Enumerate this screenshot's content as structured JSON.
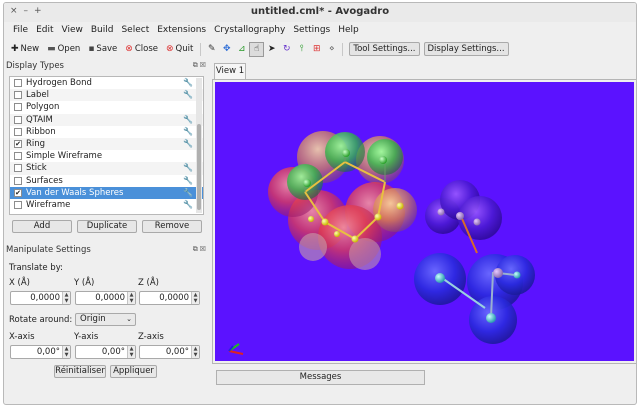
{
  "window": {
    "controls": [
      "×",
      "–",
      "+"
    ],
    "title": "untitled.cml* - Avogadro"
  },
  "menu": [
    "File",
    "Edit",
    "View",
    "Build",
    "Select",
    "Extensions",
    "Crystallography",
    "Settings",
    "Help"
  ],
  "toolbar": {
    "new": "New",
    "open": "Open",
    "save": "Save",
    "close": "Close",
    "quit": "Quit",
    "tool_settings": "Tool Settings...",
    "display_settings": "Display Settings..."
  },
  "display_types": {
    "title": "Display Types",
    "items": [
      {
        "label": "Hydrogen Bond",
        "checked": false,
        "settings": true
      },
      {
        "label": "Label",
        "checked": false,
        "settings": true
      },
      {
        "label": "Polygon",
        "checked": false,
        "settings": false
      },
      {
        "label": "QTAIM",
        "checked": false,
        "settings": true
      },
      {
        "label": "Ribbon",
        "checked": false,
        "settings": true
      },
      {
        "label": "Ring",
        "checked": true,
        "settings": true
      },
      {
        "label": "Simple Wireframe",
        "checked": false,
        "settings": false
      },
      {
        "label": "Stick",
        "checked": false,
        "settings": true
      },
      {
        "label": "Surfaces",
        "checked": false,
        "settings": true
      },
      {
        "label": "Van der Waals Spheres",
        "checked": true,
        "settings": true,
        "selected": true
      },
      {
        "label": "Wireframe",
        "checked": false,
        "settings": true
      }
    ],
    "add": "Add",
    "duplicate": "Duplicate",
    "remove": "Remove"
  },
  "manipulate": {
    "title": "Manipulate Settings",
    "translate_by": "Translate by:",
    "x_label": "X (Å)",
    "y_label": "Y (Å)",
    "z_label": "Z (Å)",
    "x_value": "0,0000",
    "y_value": "0,0000",
    "z_value": "0,0000",
    "rotate_around": "Rotate around:",
    "rotate_option": "Origin",
    "x_axis": "X-axis",
    "y_axis": "Y-axis",
    "z_axis": "Z-axis",
    "x_angle": "0,00°",
    "y_angle": "0,00°",
    "z_angle": "0,00°",
    "reset": "Réinitialiser",
    "apply": "Appliquer"
  },
  "view": {
    "tab": "View 1",
    "background": "#5b12ff",
    "messages": "Messages"
  },
  "icons": [
    "new-icon",
    "open-icon",
    "save-icon",
    "close-icon",
    "quit-icon",
    "draw-tool-icon",
    "navigate-tool-icon",
    "measure-tool-icon",
    "manipulate-tool-icon",
    "select-tool-icon",
    "rotate-tool-icon",
    "align-tool-icon",
    "extension-tool-icon",
    "autoopt-tool-icon"
  ]
}
